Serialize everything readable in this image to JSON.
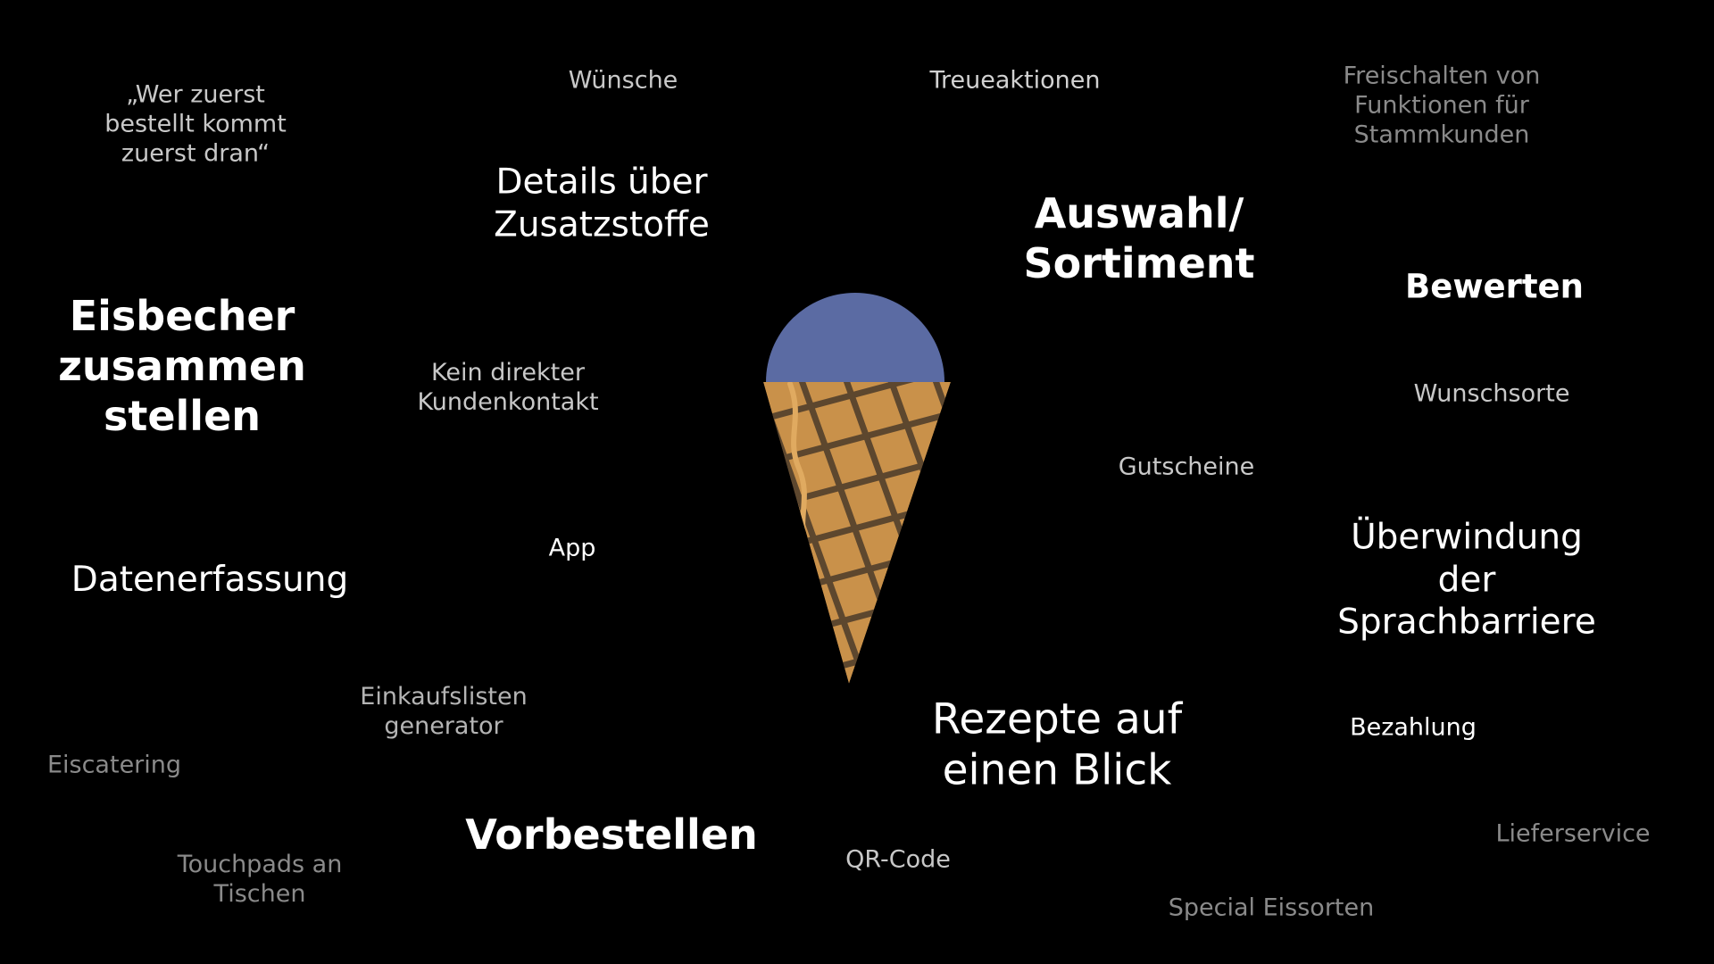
{
  "slide": {
    "background": "#000000",
    "words": [
      {
        "id": "wer-zuerst",
        "text": "„Wer zuerst\nbestellt kommt\nzuerst dran“",
        "color": "#c8c8c8"
      },
      {
        "id": "wuensche",
        "text": "Wünsche",
        "color": "#c8c8c8"
      },
      {
        "id": "treueaktionen",
        "text": "Treueaktionen",
        "color": "#d2d2d2"
      },
      {
        "id": "freischalten",
        "text": "Freischalten von\nFunktionen für\nStammkunden",
        "color": "#8a8a8a"
      },
      {
        "id": "details-zusatzstoffe",
        "text": "Details über\nZusatzstoffe",
        "color": "#ffffff"
      },
      {
        "id": "auswahl-sortiment",
        "text": "Auswahl/\nSortiment",
        "color": "#ffffff"
      },
      {
        "id": "bewerten",
        "text": "Bewerten",
        "color": "#ffffff"
      },
      {
        "id": "eisbecher",
        "text": "Eisbecher\nzusammen\nstellen",
        "color": "#ffffff"
      },
      {
        "id": "kein-kundenkontakt",
        "text": "Kein direkter\nKundenkontakt",
        "color": "#c8c8c8"
      },
      {
        "id": "wunschsorte",
        "text": "Wunschsorte",
        "color": "#c8c8c8"
      },
      {
        "id": "gutscheine",
        "text": "Gutscheine",
        "color": "#c8c8c8"
      },
      {
        "id": "app",
        "text": "App",
        "color": "#ffffff"
      },
      {
        "id": "datenerfassung",
        "text": "Datenerfassung",
        "color": "#ffffff"
      },
      {
        "id": "sprachbarriere",
        "text": "Überwindung der\nSprachbarriere",
        "color": "#ffffff"
      },
      {
        "id": "einkaufslisten",
        "text": "Einkaufslisten\ngenerator",
        "color": "#b4b4b4"
      },
      {
        "id": "rezepte",
        "text": "Rezepte auf\neinen Blick",
        "color": "#ffffff"
      },
      {
        "id": "bezahlung",
        "text": "Bezahlung",
        "color": "#ffffff"
      },
      {
        "id": "eiscatering",
        "text": "Eiscatering",
        "color": "#8a8a8a"
      },
      {
        "id": "vorbestellen",
        "text": "Vorbestellen",
        "color": "#ffffff"
      },
      {
        "id": "qr-code",
        "text": "QR-Code",
        "color": "#c8c8c8"
      },
      {
        "id": "lieferservice",
        "text": "Lieferservice",
        "color": "#8a8a8a"
      },
      {
        "id": "touchpads",
        "text": "Touchpads an\nTischen",
        "color": "#8a8a8a"
      },
      {
        "id": "special-eissorten",
        "text": "Special Eissorten",
        "color": "#8a8a8a"
      }
    ],
    "ice_cream": {
      "scoop_color": "#5b6ba3",
      "cone_color": "#c9914a",
      "waffle_color": "#4a3a2a",
      "drip_color": "#e0aa60"
    }
  }
}
